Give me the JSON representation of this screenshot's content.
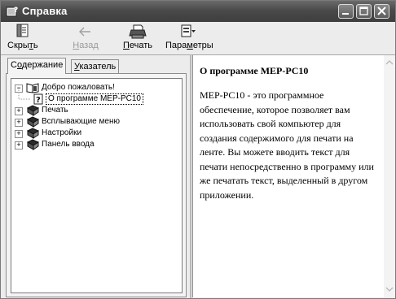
{
  "window": {
    "title": "Справка",
    "buttons": [
      "minimize-icon",
      "maximize-icon",
      "close-icon"
    ]
  },
  "toolbar": {
    "hide": {
      "prefix": "Скры",
      "underline": "т",
      "suffix": "ь"
    },
    "back": {
      "prefix": "",
      "underline": "Н",
      "suffix": "азад",
      "disabled": true
    },
    "print": {
      "prefix": "",
      "underline": "П",
      "suffix": "ечать"
    },
    "options": {
      "prefix": "Пара",
      "underline": "м",
      "suffix": "етры"
    }
  },
  "tabs": {
    "contents": {
      "prefix": "С",
      "underline": "о",
      "suffix": "держание"
    },
    "index": {
      "prefix": "",
      "underline": "У",
      "suffix": "казатель"
    }
  },
  "tree": {
    "items": [
      {
        "label": "Добро пожаловать!",
        "icon": "open-book-icon",
        "expander": "−"
      },
      {
        "label": "О программе MEP-PC10",
        "icon": "help-page-icon",
        "selected": true
      },
      {
        "label": "Печать",
        "icon": "closed-book-icon",
        "expander": "+"
      },
      {
        "label": "Всплывающие меню",
        "icon": "closed-book-icon",
        "expander": "+"
      },
      {
        "label": "Настройки",
        "icon": "closed-book-icon",
        "expander": "+"
      },
      {
        "label": "Панель ввода",
        "icon": "closed-book-icon",
        "expander": "+"
      }
    ]
  },
  "content": {
    "heading": "О программе MEP-PC10",
    "body": "MEP-PC10 - это программное обеспечение, которое позволяет вам использовать свой компьютер для создания содержимого для печати на ленте. Вы можете вводить текст для печати непосредственно в программу или же печатать текст, выделенный в другом приложении."
  }
}
